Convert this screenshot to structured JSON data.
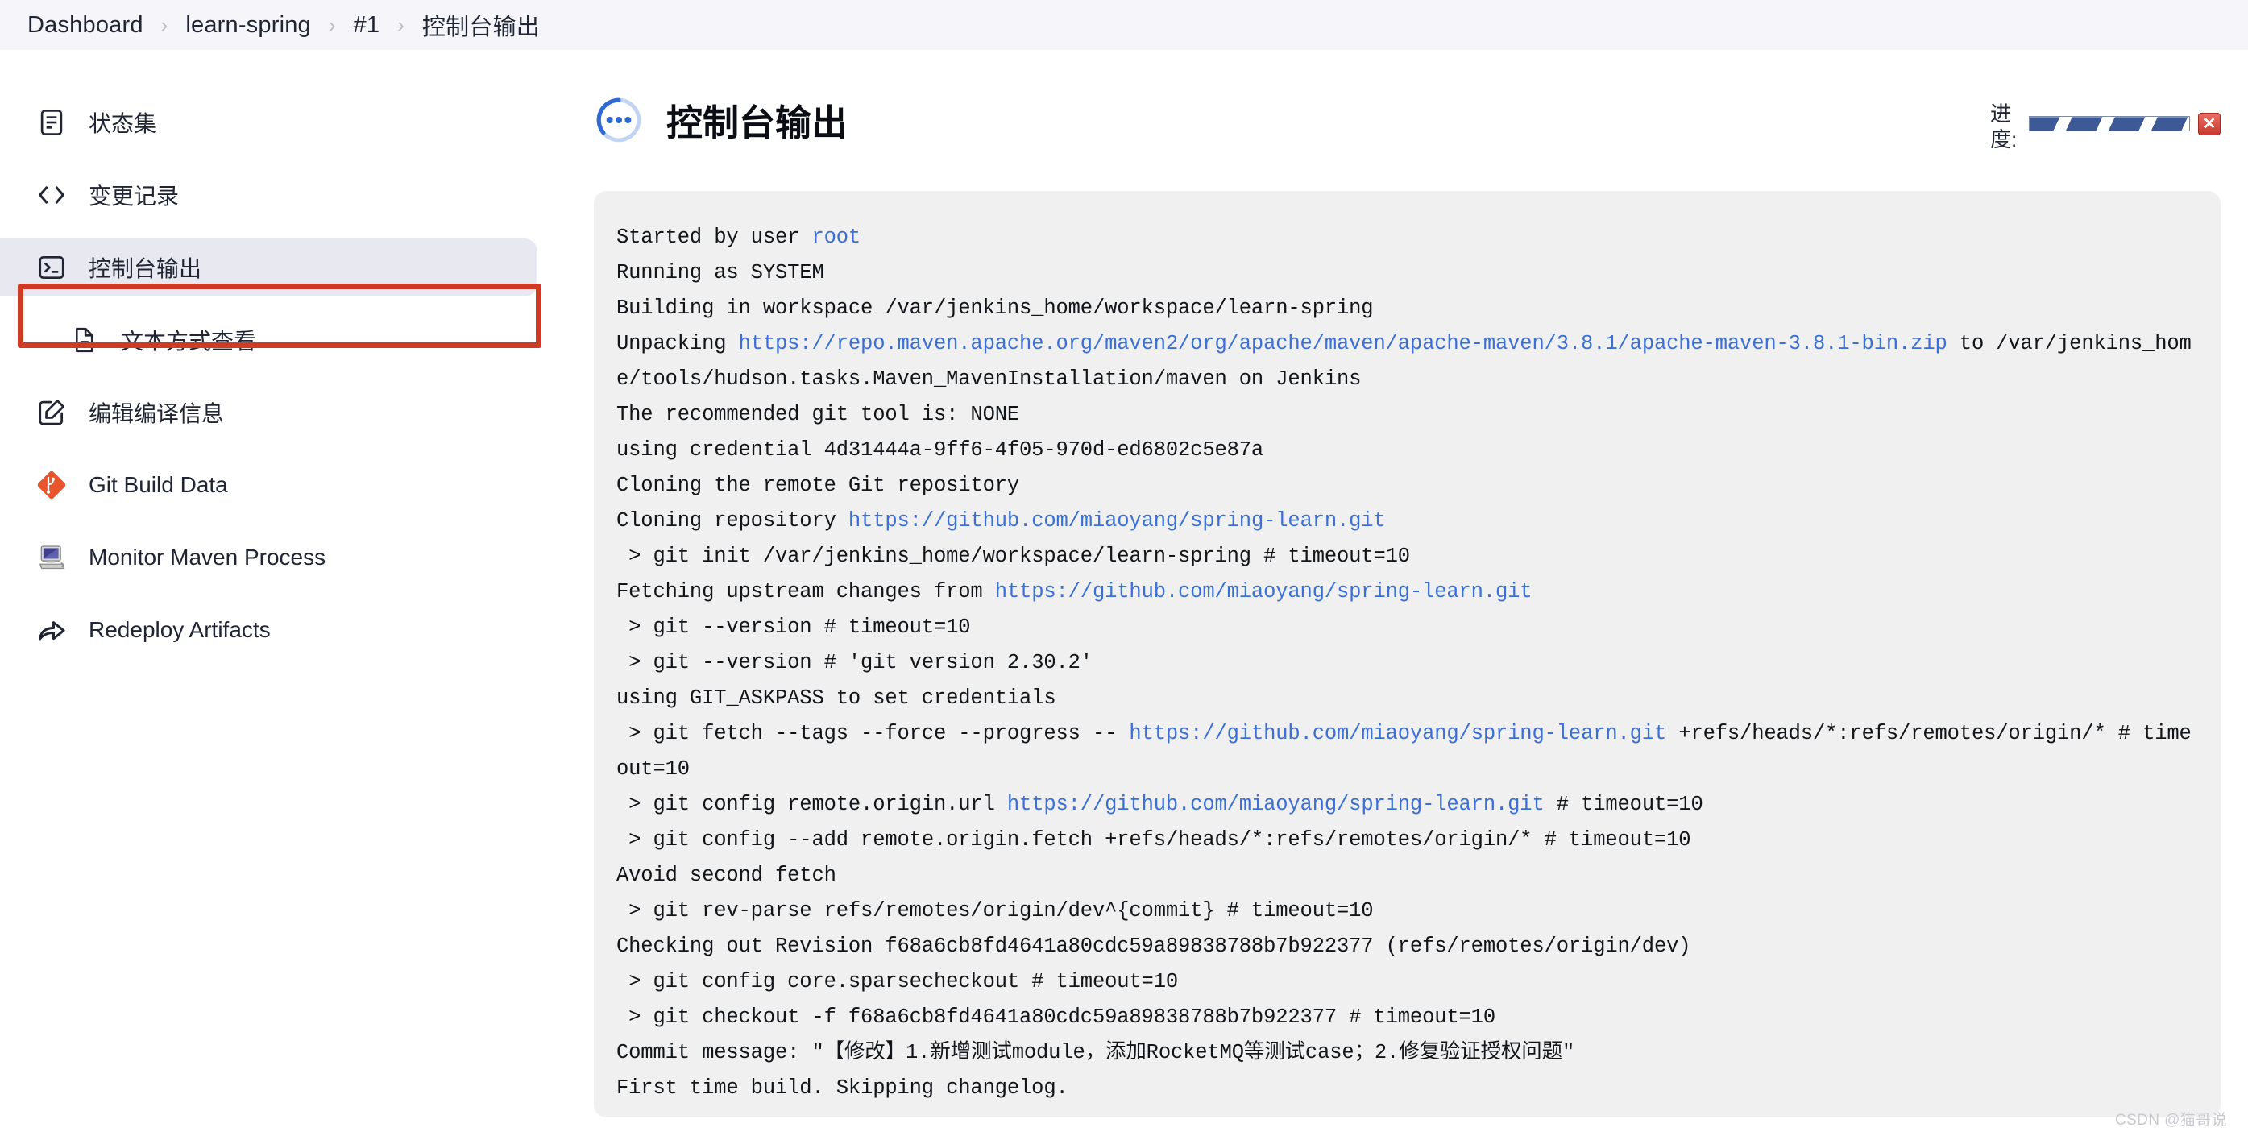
{
  "breadcrumb": {
    "separator": "›",
    "items": [
      "Dashboard",
      "learn-spring",
      "#1",
      "控制台输出"
    ]
  },
  "sidebar": {
    "items": [
      {
        "label": "状态集",
        "icon": "document-list-icon",
        "selected": false,
        "sub": false
      },
      {
        "label": "变更记录",
        "icon": "code-brackets-icon",
        "selected": false,
        "sub": false
      },
      {
        "label": "控制台输出",
        "icon": "terminal-icon",
        "selected": true,
        "sub": false
      },
      {
        "label": "文本方式查看",
        "icon": "text-file-icon",
        "selected": false,
        "sub": true
      },
      {
        "label": "编辑编译信息",
        "icon": "edit-square-icon",
        "selected": false,
        "sub": false
      },
      {
        "label": "Git Build Data",
        "icon": "git-diamond-icon",
        "selected": false,
        "sub": false
      },
      {
        "label": "Monitor Maven Process",
        "icon": "computer-icon",
        "selected": false,
        "sub": false
      },
      {
        "label": "Redeploy Artifacts",
        "icon": "share-arrow-icon",
        "selected": false,
        "sub": false
      }
    ]
  },
  "main": {
    "title": "控制台输出",
    "status_icon": "in-progress-spinner-icon",
    "progress": {
      "label": "进度:",
      "stop_button_label": "✕",
      "stop_button_icon": "close-icon"
    }
  },
  "console": {
    "lines": [
      [
        {
          "t": "Started by user "
        },
        {
          "t": "root",
          "link": true
        }
      ],
      [
        {
          "t": "Running as SYSTEM"
        }
      ],
      [
        {
          "t": "Building in workspace /var/jenkins_home/workspace/learn-spring"
        }
      ],
      [
        {
          "t": "Unpacking "
        },
        {
          "t": "https://repo.maven.apache.org/maven2/org/apache/maven/apache-maven/3.8.1/apache-maven-3.8.1-bin.zip",
          "link": true
        },
        {
          "t": " to /var/jenkins_home/tools/hudson.tasks.Maven_MavenInstallation/maven on Jenkins"
        }
      ],
      [
        {
          "t": "The recommended git tool is: NONE"
        }
      ],
      [
        {
          "t": "using credential 4d31444a-9ff6-4f05-970d-ed6802c5e87a"
        }
      ],
      [
        {
          "t": "Cloning the remote Git repository"
        }
      ],
      [
        {
          "t": "Cloning repository "
        },
        {
          "t": "https://github.com/miaoyang/spring-learn.git",
          "link": true
        }
      ],
      [
        {
          "t": " > git init /var/jenkins_home/workspace/learn-spring # timeout=10"
        }
      ],
      [
        {
          "t": "Fetching upstream changes from "
        },
        {
          "t": "https://github.com/miaoyang/spring-learn.git",
          "link": true
        }
      ],
      [
        {
          "t": " > git --version # timeout=10"
        }
      ],
      [
        {
          "t": " > git --version # 'git version 2.30.2'"
        }
      ],
      [
        {
          "t": "using GIT_ASKPASS to set credentials"
        }
      ],
      [
        {
          "t": " > git fetch --tags --force --progress -- "
        },
        {
          "t": "https://github.com/miaoyang/spring-learn.git",
          "link": true
        },
        {
          "t": " +refs/heads/*:refs/remotes/origin/* # timeout=10"
        }
      ],
      [
        {
          "t": " > git config remote.origin.url "
        },
        {
          "t": "https://github.com/miaoyang/spring-learn.git",
          "link": true
        },
        {
          "t": " # timeout=10"
        }
      ],
      [
        {
          "t": " > git config --add remote.origin.fetch +refs/heads/*:refs/remotes/origin/* # timeout=10"
        }
      ],
      [
        {
          "t": "Avoid second fetch"
        }
      ],
      [
        {
          "t": " > git rev-parse refs/remotes/origin/dev^{commit} # timeout=10"
        }
      ],
      [
        {
          "t": "Checking out Revision f68a6cb8fd4641a80cdc59a89838788b7b922377 (refs/remotes/origin/dev)"
        }
      ],
      [
        {
          "t": " > git config core.sparsecheckout # timeout=10"
        }
      ],
      [
        {
          "t": " > git checkout -f f68a6cb8fd4641a80cdc59a89838788b7b922377 # timeout=10"
        }
      ],
      [
        {
          "t": "Commit message: \"【修改】1.新增测试module，添加RocketMQ等测试case；2.修复验证授权问题\""
        }
      ],
      [
        {
          "t": "First time build. Skipping changelog."
        }
      ]
    ]
  },
  "watermark": "CSDN @猫哥说",
  "colors": {
    "accent_blue": "#3a6fd8",
    "annotation_red": "#cf3a25",
    "selected_bg": "#e7e8f0",
    "console_bg": "#f0f0f0",
    "progress_blue": "#3d5a96",
    "git_orange": "#e8552d"
  }
}
